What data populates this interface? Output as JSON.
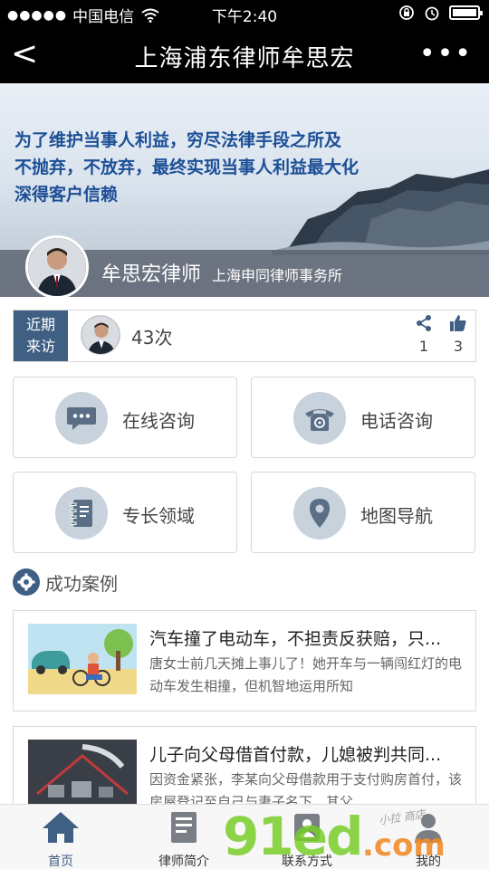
{
  "status_bar": {
    "dots": "●●●●●",
    "carrier": "中国电信",
    "time": "下午2:40"
  },
  "nav": {
    "back": "<",
    "title": "上海浦东律师牟思宏",
    "more": "•••"
  },
  "banner": {
    "slogan": [
      "为了维护当事人利益，穷尽法律手段之所及",
      "不抛弃，不放弃，最终实现当事人利益最大化",
      "深得客户信赖"
    ],
    "lawyer_name": "牟思宏律师",
    "firm_name": "上海申同律师事务所"
  },
  "visits": {
    "tag_line1": "近期",
    "tag_line2": "来访",
    "count": "43次",
    "share_count": "1",
    "like_count": "3"
  },
  "menu": [
    {
      "label": "在线咨询",
      "icon": "chat-icon"
    },
    {
      "label": "电话咨询",
      "icon": "phone-icon"
    },
    {
      "label": "专长领域",
      "icon": "notebook-icon"
    },
    {
      "label": "地图导航",
      "icon": "map-pin-icon"
    }
  ],
  "cases_section": {
    "title": "成功案例"
  },
  "cases": [
    {
      "title": "汽车撞了电动车，不担责反获赔，只...",
      "desc": "唐女士前几天摊上事儿了！她开车与一辆闯红灯的电动车发生相撞，但机智地运用所知"
    },
    {
      "title": "儿子向父母借首付款，儿媳被判共同...",
      "desc": "因资金紧张，李某向父母借款用于支付购房首付，该房屋登记至自己与妻子名下，其父"
    }
  ],
  "tabs": [
    {
      "label": "首页",
      "icon": "home-icon"
    },
    {
      "label": "律师简介",
      "icon": "profile-card-icon"
    },
    {
      "label": "联系方式",
      "icon": "contact-icon"
    },
    {
      "label": "我的",
      "icon": "user-icon"
    }
  ],
  "watermark": {
    "big": "91ed",
    "com": ".com",
    "small": "小拉 商店"
  },
  "colors": {
    "accent": "#3f5f83",
    "slogan": "#1c4f96",
    "icon_bg": "#c8d2dd"
  }
}
